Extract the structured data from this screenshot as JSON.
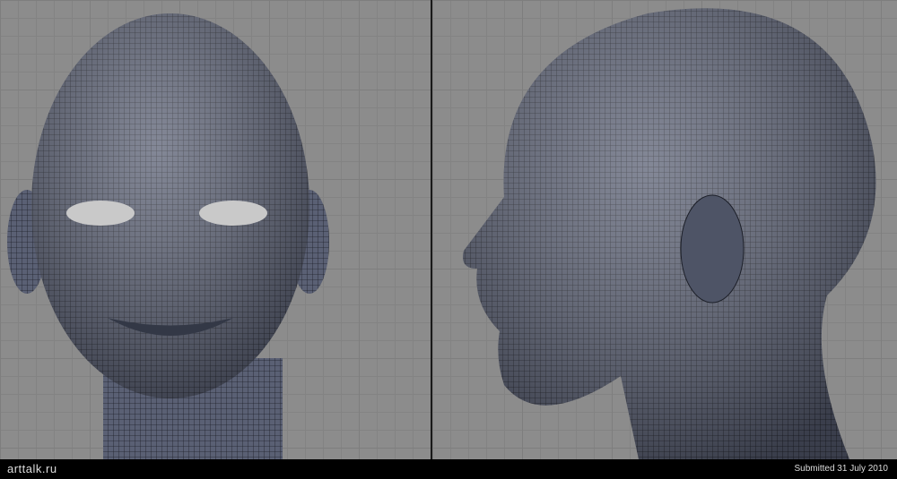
{
  "footer": {
    "logo": "arttalk.ru",
    "submitted": "Submitted 31 July 2010"
  },
  "colors": {
    "background": "#8c8c8c",
    "mesh": "#4a5064",
    "wire": "#1c1f28"
  }
}
